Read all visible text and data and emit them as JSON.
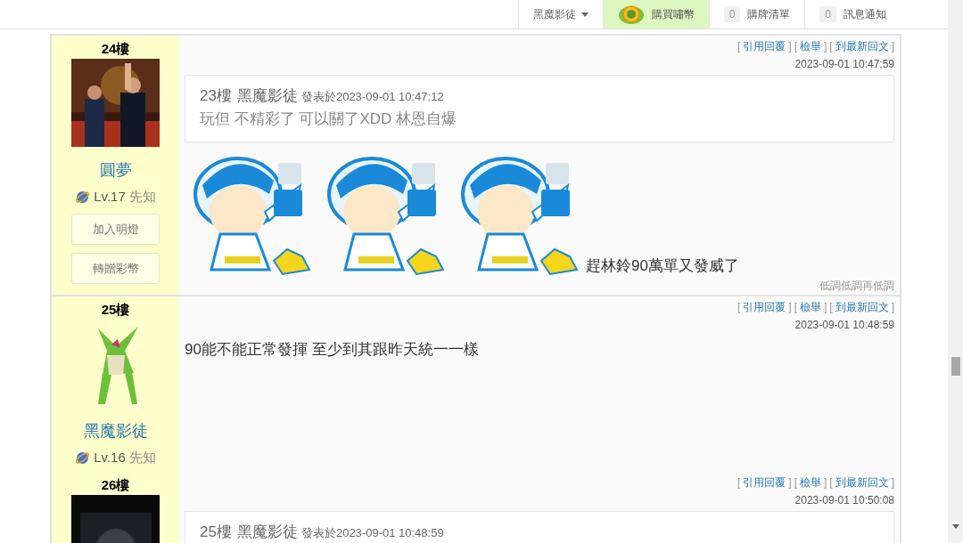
{
  "top_bar": {
    "user_menu": {
      "label": "黑魔影徒"
    },
    "items": [
      {
        "kind": "coin",
        "label": "購買嘯幣",
        "highlighted": true
      },
      {
        "kind": "count",
        "count": "0",
        "label": "購牌清單",
        "highlighted": false
      },
      {
        "kind": "count",
        "count": "0",
        "label": "訊息通知",
        "highlighted": false
      }
    ]
  },
  "brackets": [
    "[",
    "]"
  ],
  "posts": [
    {
      "floor": "24樓",
      "username": "圓夢",
      "level": "Lv.17",
      "rank": "先知",
      "buttons": [
        "加入明燈",
        "轉贈彩幣"
      ],
      "actions": [
        "引用回覆",
        "檢舉",
        "到最新回文"
      ],
      "timestamp": "2023-09-01 10:47:59",
      "quote": {
        "floor": "23樓",
        "author": "黑魔影徒",
        "posted": "發表於2023-09-01 10:47:12",
        "text": "玩但 不精彩了 可以關了XDD 林恩自爆"
      },
      "text": "趕林鈴90萬單又發威了",
      "signature": "低調低調再低調"
    },
    {
      "floor": "25樓",
      "username": "黑魔影徒",
      "level": "Lv.16",
      "rank": "先知",
      "actions": [
        "引用回覆",
        "檢舉",
        "到最新回文"
      ],
      "timestamp": "2023-09-01 10:48:59",
      "text": "90能不能正常發揮 至少到其跟昨天統一一樣"
    },
    {
      "floor": "26樓",
      "actions": [
        "引用回覆",
        "檢舉",
        "到最新回文"
      ],
      "timestamp": "2023-09-01 10:50:08",
      "quote": {
        "floor": "25樓",
        "author": "黑魔影徒",
        "posted": "發表於2023-09-01 10:48:59"
      }
    }
  ]
}
